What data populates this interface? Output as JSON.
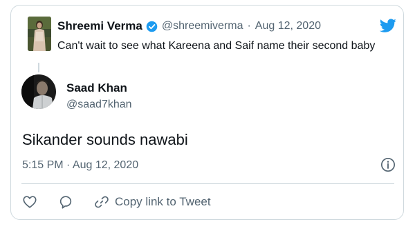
{
  "quoted_tweet": {
    "name": "Shreemi Verma",
    "handle": "@shreemiverma",
    "separator": "·",
    "date": "Aug 12, 2020",
    "text": "Can't wait to see what Kareena and Saif name their second baby"
  },
  "reply_tweet": {
    "name": "Saad Khan",
    "handle": "@saad7khan",
    "text": "Sikander sounds nawabi",
    "timestamp": "5:15 PM · Aug 12, 2020"
  },
  "actions": {
    "copy_link_label": "Copy link to Tweet"
  },
  "icons": [
    "twitter-bird-icon",
    "verified-badge-icon",
    "info-icon",
    "heart-icon",
    "reply-icon",
    "link-icon"
  ],
  "colors": {
    "twitter_blue": "#1d9bf0",
    "text_primary": "#0f1419",
    "text_muted": "#536471",
    "border": "#cfd9de"
  }
}
